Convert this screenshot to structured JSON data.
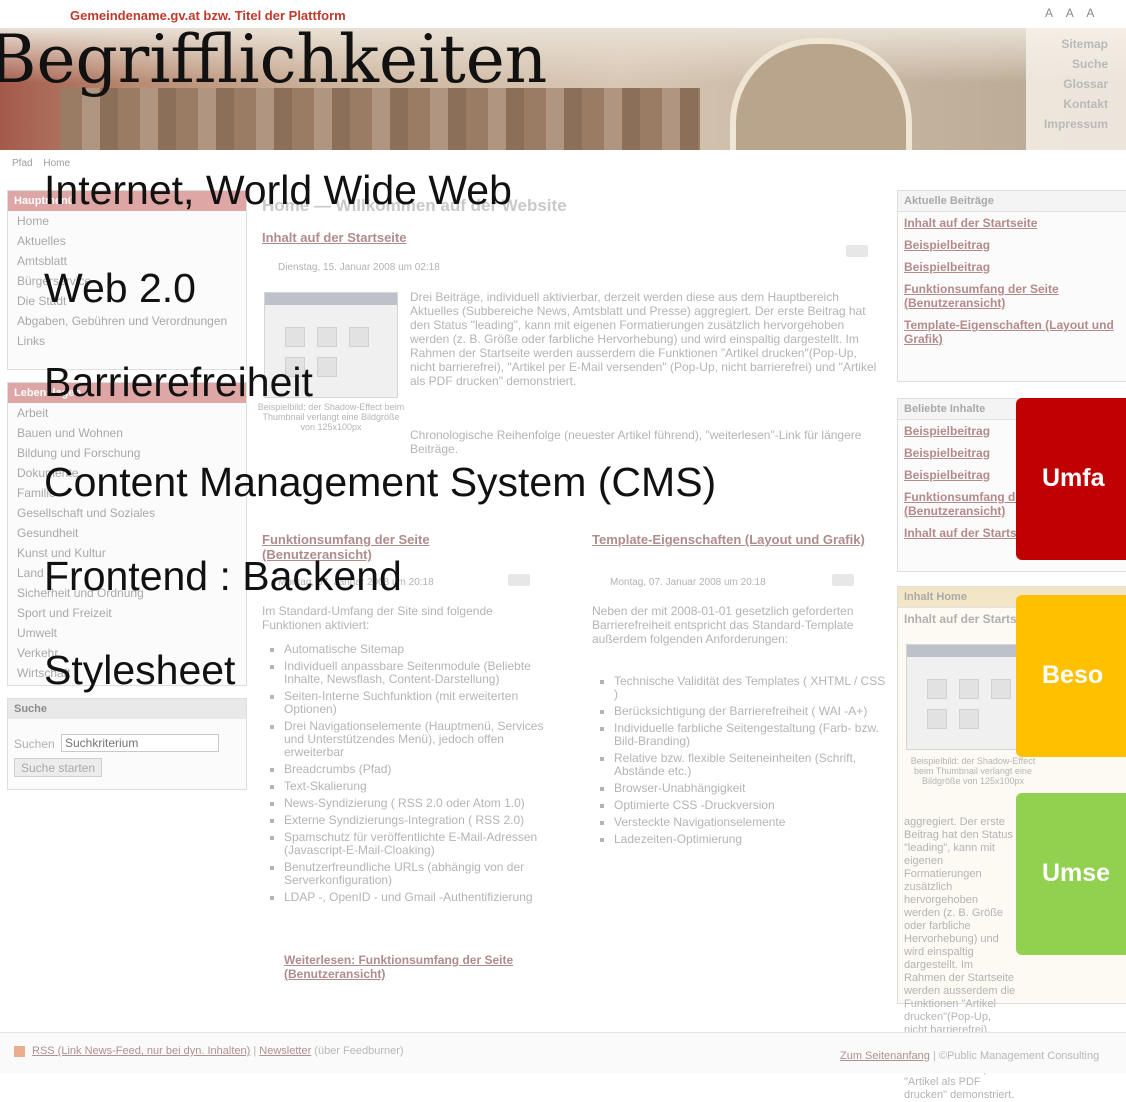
{
  "slide": {
    "title": "Begrifflichkeiten",
    "terms": [
      "Internet, World Wide Web",
      "Web 2.0",
      "Barrierefreiheit",
      "Content Management System (CMS)",
      "Frontend : Backend",
      "Stylesheet"
    ],
    "tiles": [
      {
        "label": "Umfa",
        "color": "#c00000"
      },
      {
        "label": "Beso",
        "color": "#ffc000"
      },
      {
        "label": "Umse",
        "color": "#92d050"
      }
    ]
  },
  "website": {
    "site_title": "Gemeindename.gv.at bzw. Titel der Plattform",
    "font_size_icons": [
      "A",
      "A",
      "A"
    ],
    "top_links": [
      "Sitemap",
      "Suche",
      "Glossar",
      "Kontakt",
      "Impressum"
    ],
    "path": {
      "label": "Pfad",
      "current": "Home"
    },
    "main_menu": {
      "header": "Hauptmenü",
      "items": [
        "Home",
        "Aktuelles",
        "Amtsblatt",
        "Bürgerservice",
        "Die Stadt",
        "Abgaben, Gebühren und Verordnungen",
        "Links"
      ]
    },
    "life_menu": {
      "header": "Lebenslagen",
      "items": [
        "Arbeit",
        "Bauen und Wohnen",
        "Bildung und Forschung",
        "Dokumente",
        "Familie",
        "Gesellschaft und Soziales",
        "Gesundheit",
        "Kunst und Kultur",
        "Land",
        "Sicherheit und Ordnung",
        "Sport und Freizeit",
        "Umwelt",
        "Verkehr",
        "Wirtschaft"
      ]
    },
    "search": {
      "header": "Suche",
      "label": "Suchen",
      "placeholder": "Suchkriterium",
      "button": "Suche starten"
    },
    "content": {
      "page_heading": "Home — Willkommen auf der Website",
      "lead_article": {
        "title": "Inhalt auf der Startseite",
        "date": "Dienstag, 15. Januar 2008 um 02:18",
        "text": "Drei Beiträge, individuell aktivierbar, derzeit werden diese aus dem Hauptbereich Aktuelles (Subbereiche News, Amtsblatt und Presse) aggregiert. Der erste Beitrag hat den Status \"leading\", kann mit eigenen Formatierungen zusätzlich hervorgehoben werden (z. B. Größe oder farbliche Hervorhebung) und wird einspaltig dargestellt. Im Rahmen der Startseite werden ausserdem die Funktionen \"Artikel drucken\"(Pop-Up, nicht barrierefrei), \"Artikel per E-Mail versenden\" (Pop-Up, nicht barrierefrei) und \"Artikel als PDF drucken\" demonstriert.",
        "text2": "Chronologische Reihenfolge (neuester Artikel führend), \"weiterlesen\"-Link für längere Beiträge.",
        "caption": "Beispielbild: der Shadow-Effect beim Thumbnail verlangt eine Bildgröße von 125x100px"
      },
      "article_left": {
        "title": "Funktionsumfang der Seite (Benutzeransicht)",
        "date": "Montag, 07. Januar 2008 um 20:18",
        "intro": "Im Standard-Umfang der Site sind folgende Funktionen aktiviert:",
        "bullets": [
          "Automatische Sitemap",
          "Individuell anpassbare Seitenmodule (Beliebte Inhalte, Newsflash, Content-Darstellung)",
          "Seiten-Interne Suchfunktion (mit erweiterten Optionen)",
          "Drei Navigationselemente (Hauptmenü, Services und Unterstützendes Menü), jedoch offen erweiterbar",
          "Breadcrumbs (Pfad)",
          "Text-Skalierung",
          "News-Syndizierung ( RSS 2.0 oder Atom 1.0)",
          "Externe Syndizierungs-Integration ( RSS 2.0)",
          "Spamschutz für veröffentlichte E-Mail-Adressen (Javascript-E-Mail-Cloaking)",
          "Benutzerfreundliche URLs (abhängig von der Serverkonfiguration)",
          "LDAP -, OpenID - und Gmail -Authentifizierung"
        ],
        "more": "Weiterlesen: Funktionsumfang der Seite (Benutzeransicht)"
      },
      "article_right": {
        "title": "Template-Eigenschaften (Layout und Grafik)",
        "date": "Montag, 07. Januar 2008 um 20:18",
        "intro": "Neben der mit 2008-01-01 gesetzlich geforderten Barrierefreiheit entspricht das Standard-Template außerdem folgenden Anforderungen:",
        "bullets": [
          "Technische Validität des Templates ( XHTML / CSS )",
          "Berücksichtigung der Barrierefreiheit ( WAI -A+)",
          "Individuelle farbliche Seitengestaltung (Farb- bzw. Bild-Branding)",
          "Relative bzw. flexible Seiteneinheiten (Schrift, Abstände etc.)",
          "Browser-Unabhängigkeit",
          "Optimierte CSS -Druckversion",
          "Versteckte Navigationselemente",
          "Ladezeiten-Optimierung"
        ]
      }
    },
    "right_column": {
      "recent": {
        "header": "Aktuelle Beiträge",
        "items": [
          "Inhalt auf der Startseite",
          "Beispielbeitrag",
          "Beispielbeitrag",
          "Funktionsumfang der Seite (Benutzeransicht)",
          "Template-Eigenschaften (Layout und Grafik)"
        ]
      },
      "popular": {
        "header": "Beliebte Inhalte",
        "items": [
          "Beispielbeitrag",
          "Beispielbeitrag",
          "Beispielbeitrag",
          "Funktionsumfang der Seite (Benutzeransicht)",
          "Inhalt auf der Startseite"
        ]
      },
      "home_box": {
        "header": "Inhalt Home",
        "title": "Inhalt auf der Startseite",
        "caption": "Beispielbild: der Shadow-Effect beim Thumbnail verlangt eine Bildgröße von 125x100px",
        "text": "aggregiert. Der erste Beitrag hat den Status \"leading\", kann mit eigenen Formatierungen zusätzlich hervorgehoben werden (z. B. Größe oder farbliche Hervorhebung) und wird einspaltig dargestellt. Im Rahmen der Startseite werden ausserdem die Funktionen \"Artikel drucken\"(Pop-Up, nicht barrierefrei), \"Artikel per E-Mail versenden\" (Pop-Up, nicht barrierefrei) und \"Artikel als PDF drucken\" demonstriert."
      }
    },
    "footer": {
      "rss": "RSS (Link News-Feed, nur bei dyn. Inhalten)",
      "separator": " | ",
      "newsletter": "Newsletter",
      "newsletter_note": " (über Feedburner)",
      "top_link": "Zum Seitenanfang",
      "copyright": " | ©Public Management Consulting"
    }
  }
}
